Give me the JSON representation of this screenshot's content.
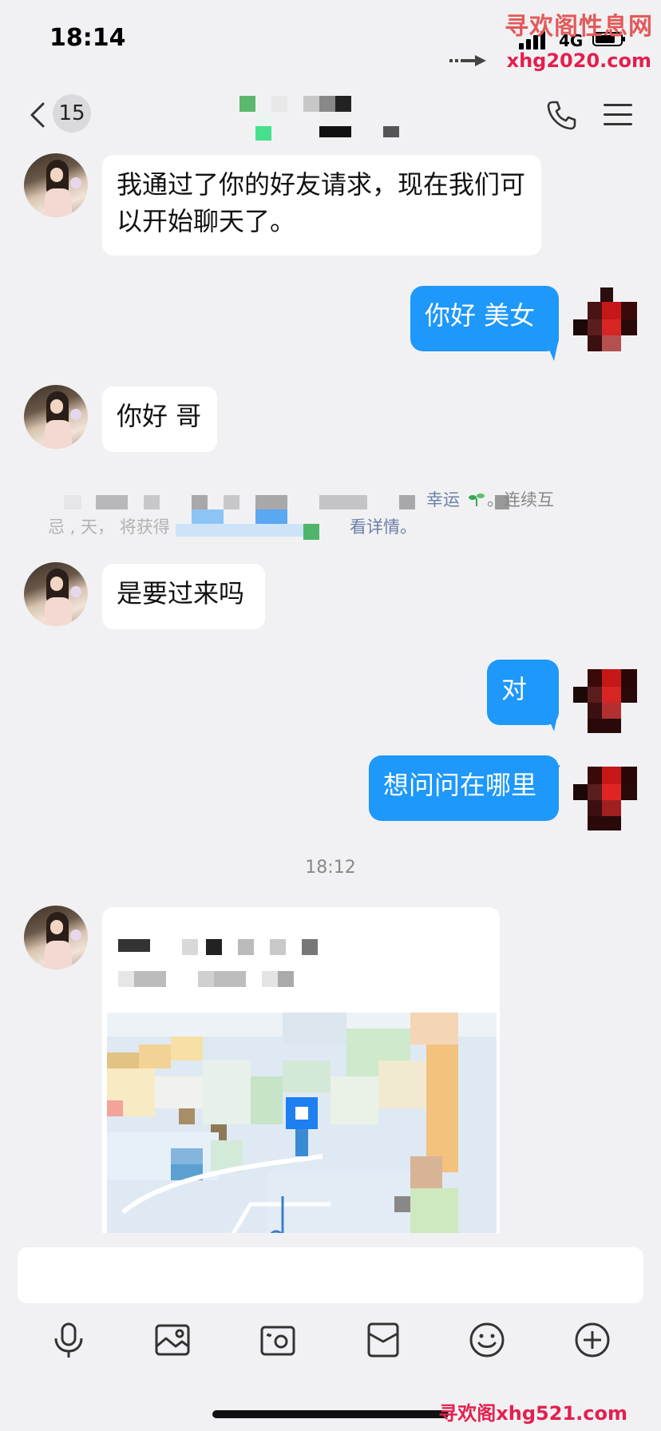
{
  "status_bar": {
    "time": "18:14",
    "network": "4G"
  },
  "watermark": {
    "top_title": "寻欢阁性息网",
    "top_url": "xhg2020.com",
    "bottom": "寻欢阁xhg521.com"
  },
  "nav": {
    "unread_count": "15",
    "contact_name": "",
    "phone_icon": "phone-icon",
    "menu_icon": "menu-icon"
  },
  "messages": [
    {
      "side": "in",
      "text": "我通过了你的好友请求，现在我们可以开始聊天了。"
    },
    {
      "side": "out",
      "text": "你好  美女"
    },
    {
      "side": "in",
      "text": "你好 哥"
    },
    {
      "side": "in",
      "text": "是要过来吗"
    },
    {
      "side": "out",
      "text": "对"
    },
    {
      "side": "out",
      "text": "想问问在哪里"
    }
  ],
  "system_notice": {
    "lucky_text": "幸运",
    "continue_text": "。连续互",
    "prefix_text": "忌 ,  天，  将获得",
    "detail_link": "看详情。"
  },
  "timestamp": "18:12",
  "location_card": {
    "title": "",
    "address": ""
  },
  "input": {
    "placeholder": ""
  },
  "toolbar": [
    "mic-icon",
    "image-icon",
    "camera-icon",
    "red-packet-icon",
    "emoji-icon",
    "plus-icon"
  ],
  "colors": {
    "bubble_out": "#1e98fa",
    "bubble_in": "#ffffff",
    "background": "#f1f1f3",
    "link": "#4a7fd1"
  }
}
